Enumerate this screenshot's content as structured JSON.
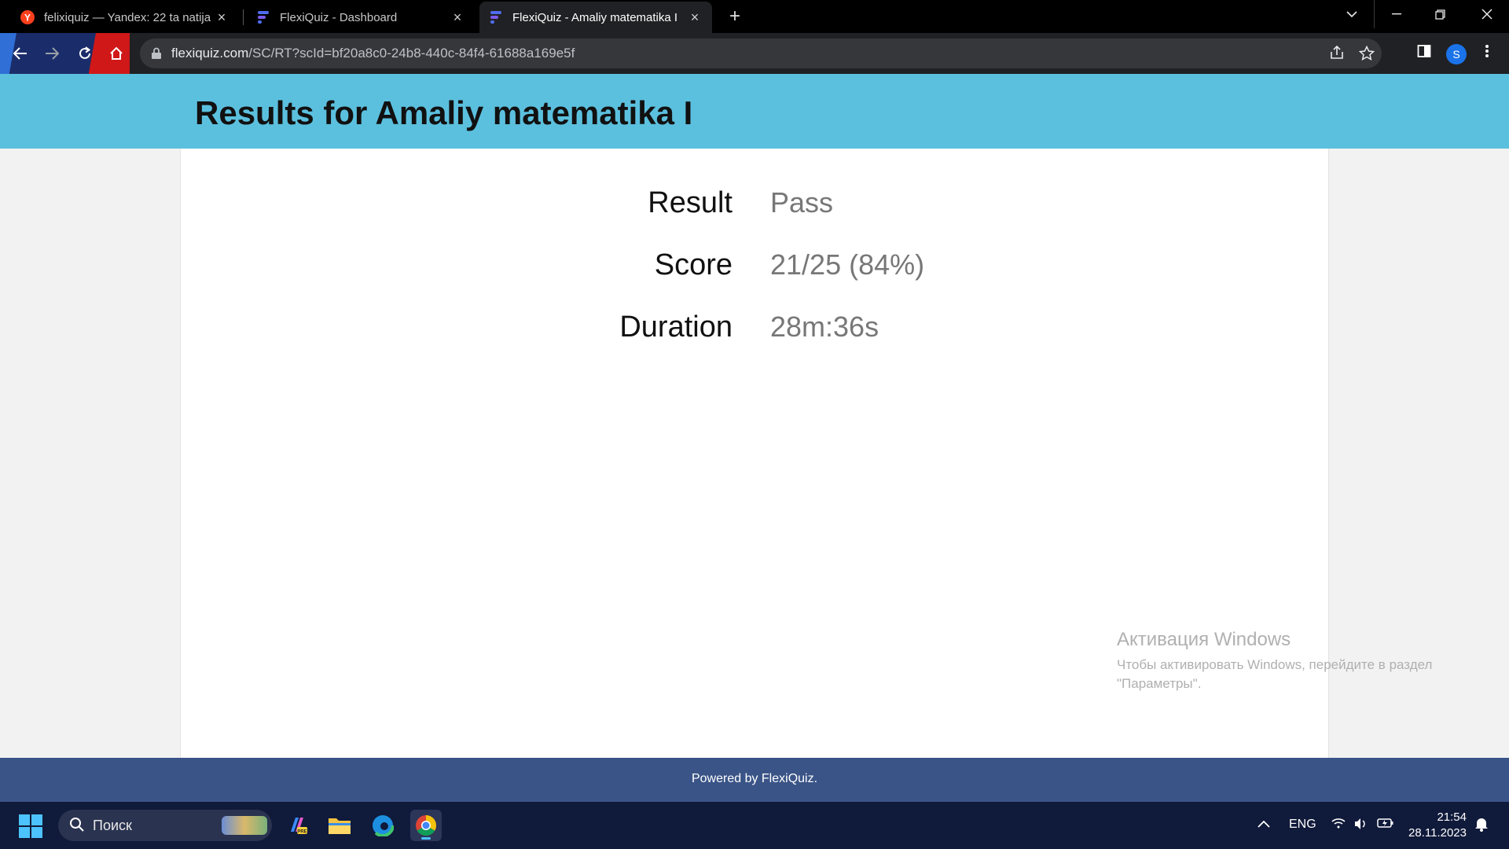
{
  "browser": {
    "tabs": [
      {
        "title": "felixiquiz — Yandex: 22 ta natija",
        "icon": "yandex-icon",
        "active": false
      },
      {
        "title": "FlexiQuiz - Dashboard",
        "icon": "flexiquiz-icon",
        "active": false
      },
      {
        "title": "FlexiQuiz - Amaliy matematika I",
        "icon": "flexiquiz-icon",
        "active": true
      }
    ],
    "url_host": "flexiquiz.com",
    "url_path": "/SC/RT?scId=bf20a8c0-24b8-440c-84f4-61688a169e5f",
    "profile_initial": "S",
    "colors": {
      "tab_strip": "#000000",
      "toolbar": "#202124",
      "omnibox": "#36373a",
      "profile": "#1a73e8"
    }
  },
  "page": {
    "title": "Results for Amaliy matematika I",
    "results": [
      {
        "label": "Result",
        "value": "Pass"
      },
      {
        "label": "Score",
        "value": "21/25 (84%)"
      },
      {
        "label": "Duration",
        "value": "28m:36s"
      }
    ],
    "footer": "Powered by FlexiQuiz.",
    "colors": {
      "header": "#5bc0de",
      "footer": "#3a5487",
      "value_text": "#777777"
    }
  },
  "watermark": {
    "title": "Активация Windows",
    "line1": "Чтобы активировать Windows, перейдите в раздел",
    "line2": "\"Параметры\"."
  },
  "taskbar": {
    "search_label": "Поиск",
    "language": "ENG",
    "time": "21:54",
    "date": "28.11.2023",
    "apps": [
      "copilot-app-icon",
      "file-explorer-icon",
      "edge-icon",
      "chrome-icon"
    ]
  }
}
